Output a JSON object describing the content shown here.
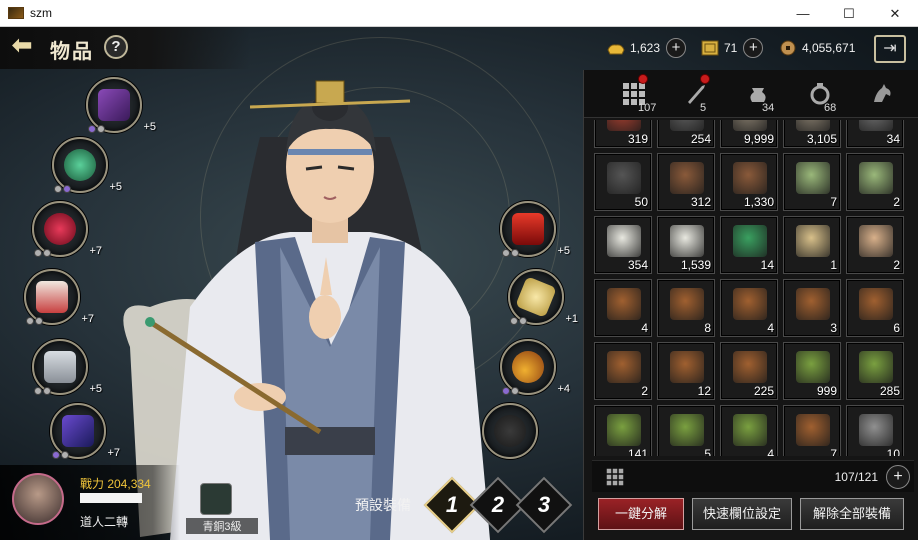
{
  "window": {
    "title": "szm",
    "controls": {
      "minimize": "—",
      "maximize": "☐",
      "close": "✕"
    }
  },
  "header": {
    "title": "物品",
    "help": "?",
    "back": "⬅"
  },
  "currencies": [
    {
      "name": "gold-ingot",
      "value": "1,623",
      "color": "#e8b838"
    },
    {
      "name": "coupon",
      "value": "71",
      "color": "#d8b040"
    },
    {
      "name": "copper-coin",
      "value": "4,055,671",
      "color": "#c09050"
    }
  ],
  "equipment_left": [
    {
      "label": "+5",
      "color": "#6a2a8a"
    },
    {
      "label": "+5",
      "color": "#2f8a5a"
    },
    {
      "label": "+7",
      "color": "#b81a3a"
    },
    {
      "label": "+7",
      "color": "#c84040"
    },
    {
      "label": "+5",
      "color": "#9aa0a8"
    },
    {
      "label": "+7",
      "color": "#4a2aa0"
    }
  ],
  "equipment_right": [
    {
      "label": "+5",
      "color": "#b81a1a"
    },
    {
      "label": "+1",
      "color": "#d8c070"
    },
    {
      "label": "+4",
      "color": "#d8a020"
    },
    {
      "label": "",
      "color": "#3a3a3a"
    }
  ],
  "player": {
    "power": "戰力 204,334",
    "title": "道人二轉",
    "rank": "青銅3級"
  },
  "preset": {
    "label": "預設裝備",
    "slots": [
      "1",
      "2",
      "3"
    ]
  },
  "inventory": {
    "tabs": [
      {
        "name": "all",
        "count": "107",
        "badge": true
      },
      {
        "name": "weapon",
        "count": "5",
        "badge": true
      },
      {
        "name": "pot",
        "count": "34",
        "badge": false
      },
      {
        "name": "ring",
        "count": "68",
        "badge": false
      },
      {
        "name": "mount",
        "count": "",
        "badge": false
      }
    ],
    "rows": [
      [
        {
          "q": "319",
          "c": "#a84030"
        },
        {
          "q": "254",
          "c": "#606060"
        },
        {
          "q": "9,999",
          "c": "#8a8070"
        },
        {
          "q": "3,105",
          "c": "#8a8070"
        },
        {
          "q": "34",
          "c": "#707070"
        }
      ],
      [
        {
          "q": "50",
          "c": "#555555"
        },
        {
          "q": "312",
          "c": "#8a5a3a"
        },
        {
          "q": "1,330",
          "c": "#8a5a3a"
        },
        {
          "q": "7",
          "c": "#9ab87a"
        },
        {
          "q": "2",
          "c": "#9ab87a"
        }
      ],
      [
        {
          "q": "354",
          "c": "#e8e8e0"
        },
        {
          "q": "1,539",
          "c": "#e8e8e0"
        },
        {
          "q": "14",
          "c": "#3aa060"
        },
        {
          "q": "1",
          "c": "#d8c08a"
        },
        {
          "q": "2",
          "c": "#d8b08a"
        }
      ],
      [
        {
          "q": "4",
          "c": "#a06030"
        },
        {
          "q": "8",
          "c": "#a06030"
        },
        {
          "q": "4",
          "c": "#a06030"
        },
        {
          "q": "3",
          "c": "#a06030"
        },
        {
          "q": "6",
          "c": "#a06030"
        }
      ],
      [
        {
          "q": "2",
          "c": "#a06030"
        },
        {
          "q": "12",
          "c": "#a06030"
        },
        {
          "q": "225",
          "c": "#a06030"
        },
        {
          "q": "999",
          "c": "#7aa040"
        },
        {
          "q": "285",
          "c": "#7aa040"
        }
      ],
      [
        {
          "q": "141",
          "c": "#7aa040"
        },
        {
          "q": "5",
          "c": "#7aa040"
        },
        {
          "q": "4",
          "c": "#7aa040"
        },
        {
          "q": "7",
          "c": "#a06030"
        },
        {
          "q": "10",
          "c": "#909090"
        }
      ]
    ],
    "capacity": "107/121",
    "buttons": [
      "一鍵分解",
      "快速欄位設定",
      "解除全部裝備"
    ]
  }
}
